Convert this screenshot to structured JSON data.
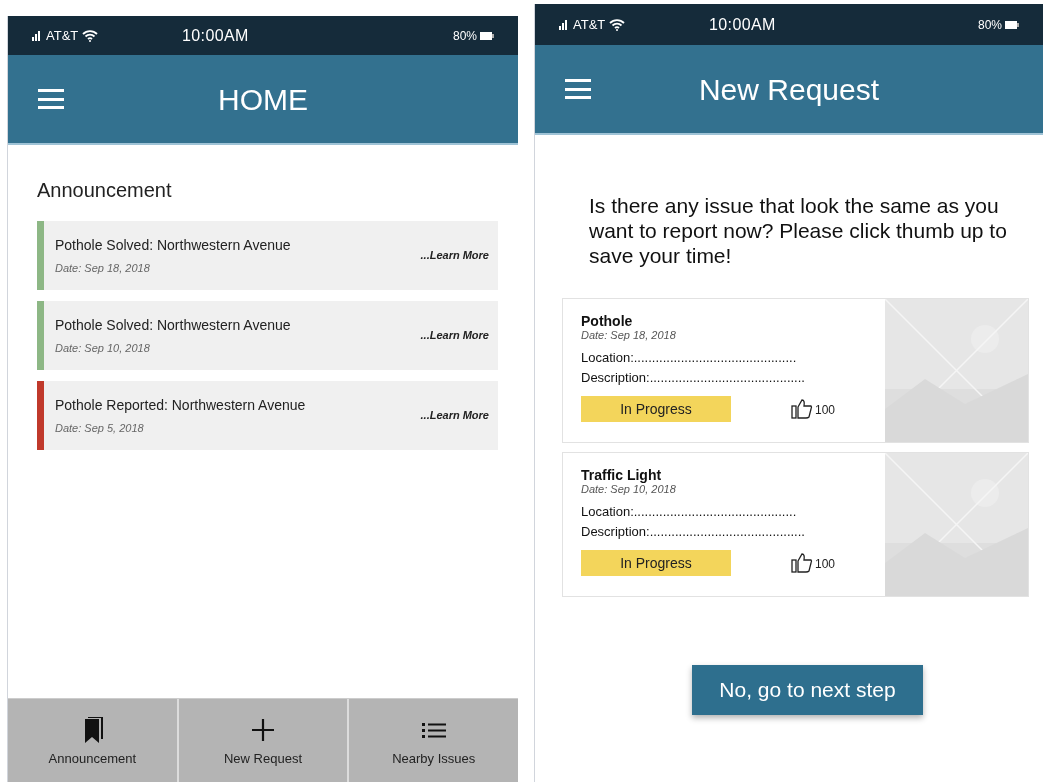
{
  "home": {
    "status_bar": {
      "carrier": "AT&T",
      "time": "10:00AM",
      "battery": "80%"
    },
    "header": {
      "title": "HOME"
    },
    "section_title": "Announcement",
    "announcements": [
      {
        "title": "Pothole Solved: Northwestern Avenue",
        "date": "Date: Sep 18, 2018",
        "link": "...Learn More",
        "color": "#8db785"
      },
      {
        "title": "Pothole Solved: Northwestern Avenue",
        "date": "Date: Sep 10, 2018",
        "link": "...Learn More",
        "color": "#8db785"
      },
      {
        "title": "Pothole Reported: Northwestern Avenue",
        "date": "Date: Sep 5, 2018",
        "link": "...Learn More",
        "color": "#c0392b"
      }
    ],
    "bottom_nav": [
      {
        "kind": "bookmark",
        "label": "Announcement"
      },
      {
        "kind": "plus",
        "label": "New Request"
      },
      {
        "kind": "list",
        "label": "Nearby Issues"
      }
    ]
  },
  "new_request": {
    "status_bar": {
      "carrier": "AT&T",
      "time": "10:00AM",
      "battery": "80%"
    },
    "header": {
      "title": "New Request"
    },
    "question": "Is there any issue that look the same as you want to report now? Please click thumb up to save your time!",
    "issues": [
      {
        "title": "Pothole",
        "date": "Date: Sep 18, 2018",
        "location": "Location:.............................................",
        "description": "Description:...........................................",
        "status": "In Progress",
        "likes": "100"
      },
      {
        "title": "Traffic Light",
        "date": "Date: Sep 10, 2018",
        "location": "Location:.............................................",
        "description": "Description:...........................................",
        "status": "In Progress",
        "likes": "100"
      }
    ],
    "button": "No, go to next step"
  }
}
